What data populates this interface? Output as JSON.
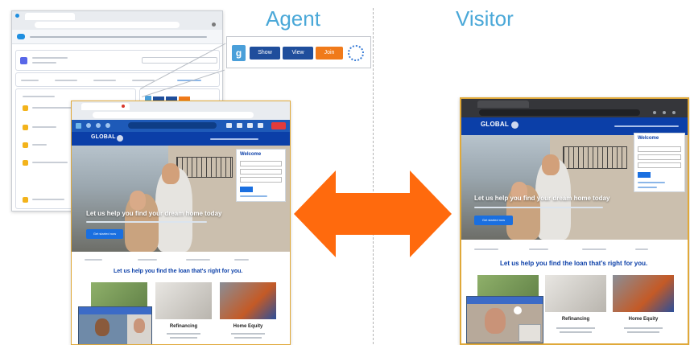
{
  "headings": {
    "agent": "Agent",
    "visitor": "Visitor"
  },
  "toolbar_zoom": {
    "show_label": "Show",
    "view_label": "View",
    "join_label": "Join",
    "colors": {
      "show": "#1f4e9c",
      "view": "#1f4e9c",
      "join": "#f07a1a",
      "logo": "#4a9fd9"
    }
  },
  "website": {
    "logo_line1": "GLOBAL",
    "logo_line2": "MORTGAGE",
    "hero_title": "Let us help you find your dream home today",
    "cta_label": "Get started now",
    "section_title": "Let us help you find the loan that's right for you.",
    "welcome_title": "Welcome",
    "cards": [
      {
        "title": "Refinancing"
      },
      {
        "title": "Home Equity"
      }
    ],
    "nav": [
      "Mortgages",
      "Refinance",
      "Home Equity",
      "Contact"
    ]
  },
  "visitor_website": {
    "hero_title": "Let us help you find your dream home today",
    "cta_label": "Get started now",
    "section_title": "Let us help you find the loan that's right for you.",
    "welcome_title": "Welcome",
    "cards": [
      {
        "title": "Refinancing"
      },
      {
        "title": "Home Equity"
      }
    ]
  },
  "colors": {
    "brand_blue": "#0b3fa8",
    "heading_blue": "#4aa8d8",
    "arrow_orange": "#ff6a0d",
    "visitor_border": "#e0a93a"
  }
}
